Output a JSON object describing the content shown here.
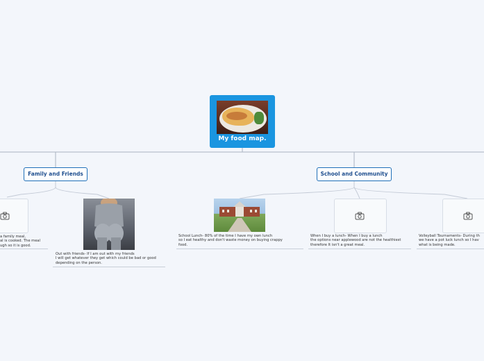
{
  "root": {
    "label": "My food map."
  },
  "branches": [
    {
      "label": "Family and Friends"
    },
    {
      "label": "School and Community"
    }
  ],
  "leaves": [
    {
      "text": "a family meal,\nal is cooked. The meal\nugh so it is good.",
      "has_photo": false
    },
    {
      "text": "Out with friends- If I am out with my friends\nI will get whatever they get which could be bad or good\ndepending on the person.",
      "has_photo": true
    },
    {
      "text": "School Lunch- 80% of the time I have my own lunch\nso I eat healthy and don't waste money on buying crappy\nfood.",
      "has_photo": true
    },
    {
      "text": "When I buy a lunch- When I buy a lunch\nthe options near applewood are not the healthiest\ntherefore It isn't a great meal.",
      "has_photo": false
    },
    {
      "text": "Volleyball Tournaments- During th\nwe have a pot luck lunch so I hav\nwhat is being made.",
      "has_photo": false
    }
  ],
  "colors": {
    "root": "#1a95e0",
    "branch_border": "#1f6fb8",
    "line": "#a9b3c2"
  },
  "icons": [
    "camera-icon"
  ]
}
